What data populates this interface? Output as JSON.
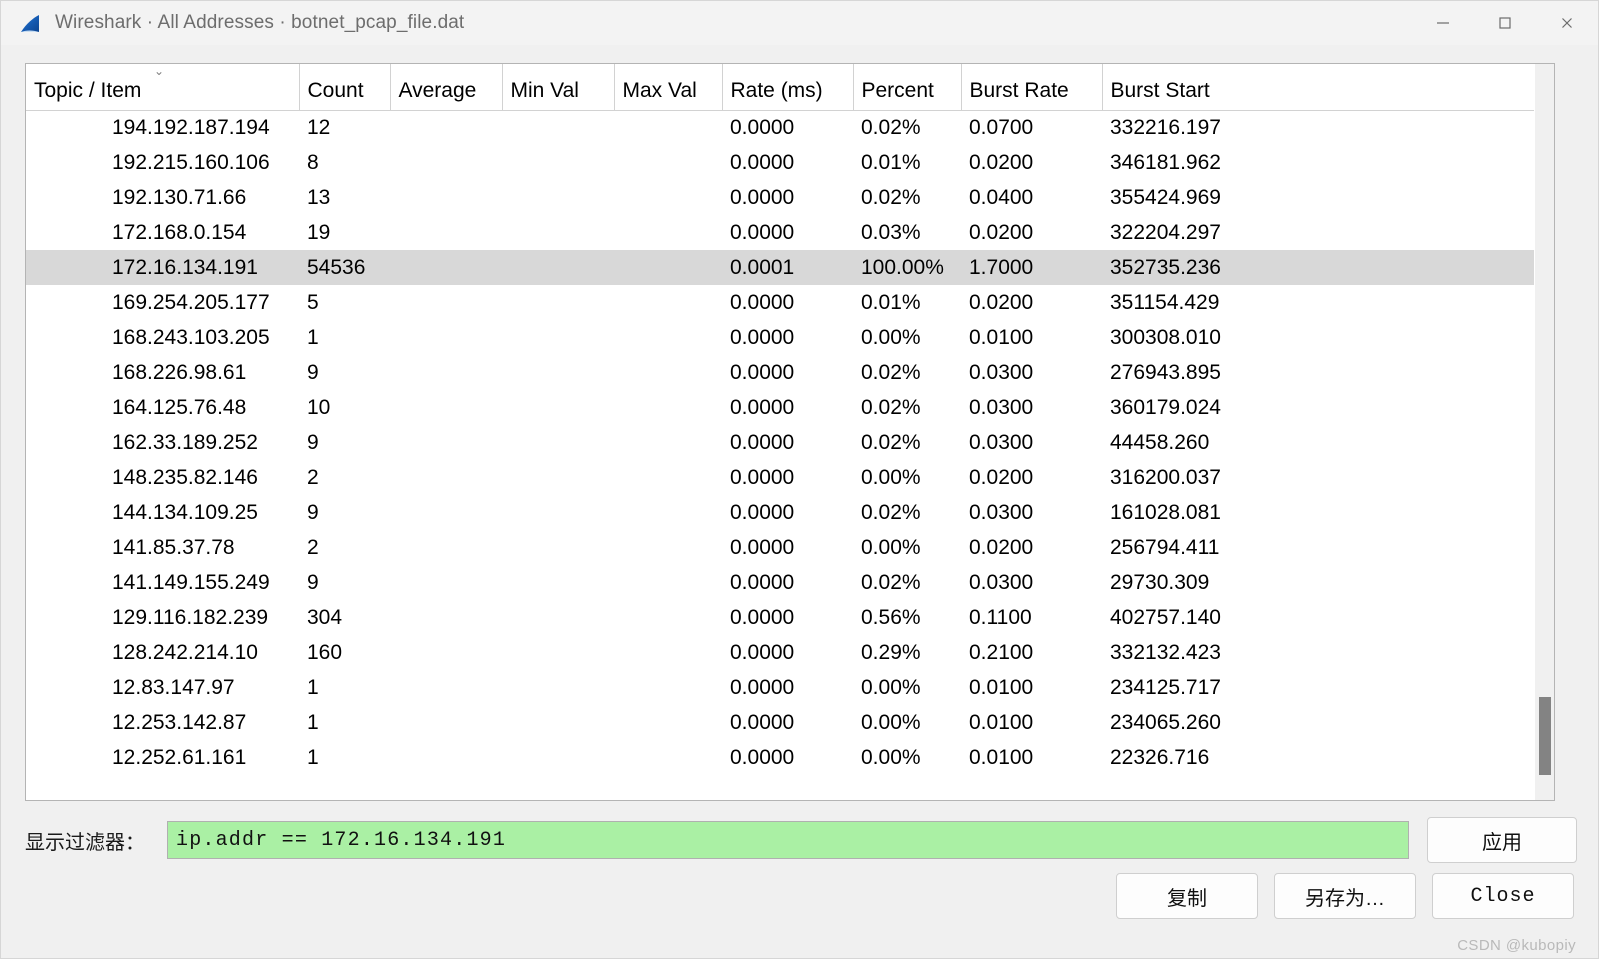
{
  "window": {
    "title": "Wireshark · All Addresses · botnet_pcap_file.dat",
    "logo_icon": "wireshark-shark-fin-icon",
    "controls": {
      "minimize": "minimize-icon",
      "maximize": "maximize-icon",
      "close": "close-icon"
    }
  },
  "table": {
    "sort_indicator": "⌄",
    "columns": [
      "Topic / Item",
      "Count",
      "Average",
      "Min Val",
      "Max Val",
      "Rate (ms)",
      "Percent",
      "Burst Rate",
      "Burst Start"
    ],
    "rows": [
      {
        "topic": "194.192.187.194",
        "count": "12",
        "average": "",
        "min": "",
        "max": "",
        "rate": "0.0000",
        "percent": "0.02%",
        "burst_rate": "0.0700",
        "burst_start": "332216.197",
        "selected": false
      },
      {
        "topic": "192.215.160.106",
        "count": "8",
        "average": "",
        "min": "",
        "max": "",
        "rate": "0.0000",
        "percent": "0.01%",
        "burst_rate": "0.0200",
        "burst_start": "346181.962",
        "selected": false
      },
      {
        "topic": "192.130.71.66",
        "count": "13",
        "average": "",
        "min": "",
        "max": "",
        "rate": "0.0000",
        "percent": "0.02%",
        "burst_rate": "0.0400",
        "burst_start": "355424.969",
        "selected": false
      },
      {
        "topic": "172.168.0.154",
        "count": "19",
        "average": "",
        "min": "",
        "max": "",
        "rate": "0.0000",
        "percent": "0.03%",
        "burst_rate": "0.0200",
        "burst_start": "322204.297",
        "selected": false
      },
      {
        "topic": "172.16.134.191",
        "count": "54536",
        "average": "",
        "min": "",
        "max": "",
        "rate": "0.0001",
        "percent": "100.00%",
        "burst_rate": "1.7000",
        "burst_start": "352735.236",
        "selected": true
      },
      {
        "topic": "169.254.205.177",
        "count": "5",
        "average": "",
        "min": "",
        "max": "",
        "rate": "0.0000",
        "percent": "0.01%",
        "burst_rate": "0.0200",
        "burst_start": "351154.429",
        "selected": false
      },
      {
        "topic": "168.243.103.205",
        "count": "1",
        "average": "",
        "min": "",
        "max": "",
        "rate": "0.0000",
        "percent": "0.00%",
        "burst_rate": "0.0100",
        "burst_start": "300308.010",
        "selected": false
      },
      {
        "topic": "168.226.98.61",
        "count": "9",
        "average": "",
        "min": "",
        "max": "",
        "rate": "0.0000",
        "percent": "0.02%",
        "burst_rate": "0.0300",
        "burst_start": "276943.895",
        "selected": false
      },
      {
        "topic": "164.125.76.48",
        "count": "10",
        "average": "",
        "min": "",
        "max": "",
        "rate": "0.0000",
        "percent": "0.02%",
        "burst_rate": "0.0300",
        "burst_start": "360179.024",
        "selected": false
      },
      {
        "topic": "162.33.189.252",
        "count": "9",
        "average": "",
        "min": "",
        "max": "",
        "rate": "0.0000",
        "percent": "0.02%",
        "burst_rate": "0.0300",
        "burst_start": "44458.260",
        "selected": false
      },
      {
        "topic": "148.235.82.146",
        "count": "2",
        "average": "",
        "min": "",
        "max": "",
        "rate": "0.0000",
        "percent": "0.00%",
        "burst_rate": "0.0200",
        "burst_start": "316200.037",
        "selected": false
      },
      {
        "topic": "144.134.109.25",
        "count": "9",
        "average": "",
        "min": "",
        "max": "",
        "rate": "0.0000",
        "percent": "0.02%",
        "burst_rate": "0.0300",
        "burst_start": "161028.081",
        "selected": false
      },
      {
        "topic": "141.85.37.78",
        "count": "2",
        "average": "",
        "min": "",
        "max": "",
        "rate": "0.0000",
        "percent": "0.00%",
        "burst_rate": "0.0200",
        "burst_start": "256794.411",
        "selected": false
      },
      {
        "topic": "141.149.155.249",
        "count": "9",
        "average": "",
        "min": "",
        "max": "",
        "rate": "0.0000",
        "percent": "0.02%",
        "burst_rate": "0.0300",
        "burst_start": "29730.309",
        "selected": false
      },
      {
        "topic": "129.116.182.239",
        "count": "304",
        "average": "",
        "min": "",
        "max": "",
        "rate": "0.0000",
        "percent": "0.56%",
        "burst_rate": "0.1100",
        "burst_start": "402757.140",
        "selected": false
      },
      {
        "topic": "128.242.214.10",
        "count": "160",
        "average": "",
        "min": "",
        "max": "",
        "rate": "0.0000",
        "percent": "0.29%",
        "burst_rate": "0.2100",
        "burst_start": "332132.423",
        "selected": false
      },
      {
        "topic": "12.83.147.97",
        "count": "1",
        "average": "",
        "min": "",
        "max": "",
        "rate": "0.0000",
        "percent": "0.00%",
        "burst_rate": "0.0100",
        "burst_start": "234125.717",
        "selected": false
      },
      {
        "topic": "12.253.142.87",
        "count": "1",
        "average": "",
        "min": "",
        "max": "",
        "rate": "0.0000",
        "percent": "0.00%",
        "burst_rate": "0.0100",
        "burst_start": "234065.260",
        "selected": false
      },
      {
        "topic": "12.252.61.161",
        "count": "1",
        "average": "",
        "min": "",
        "max": "",
        "rate": "0.0000",
        "percent": "0.00%",
        "burst_rate": "0.0100",
        "burst_start": "22326.716",
        "selected": false
      }
    ]
  },
  "filter": {
    "label": "显示过滤器：",
    "value": "ip.addr == 172.16.134.191",
    "placeholder": "",
    "valid_color": "#aaf0a4",
    "apply_label": "应用"
  },
  "buttons": {
    "copy": "复制",
    "save_as": "另存为…",
    "close": "Close"
  },
  "watermark": "CSDN @kubopiy"
}
